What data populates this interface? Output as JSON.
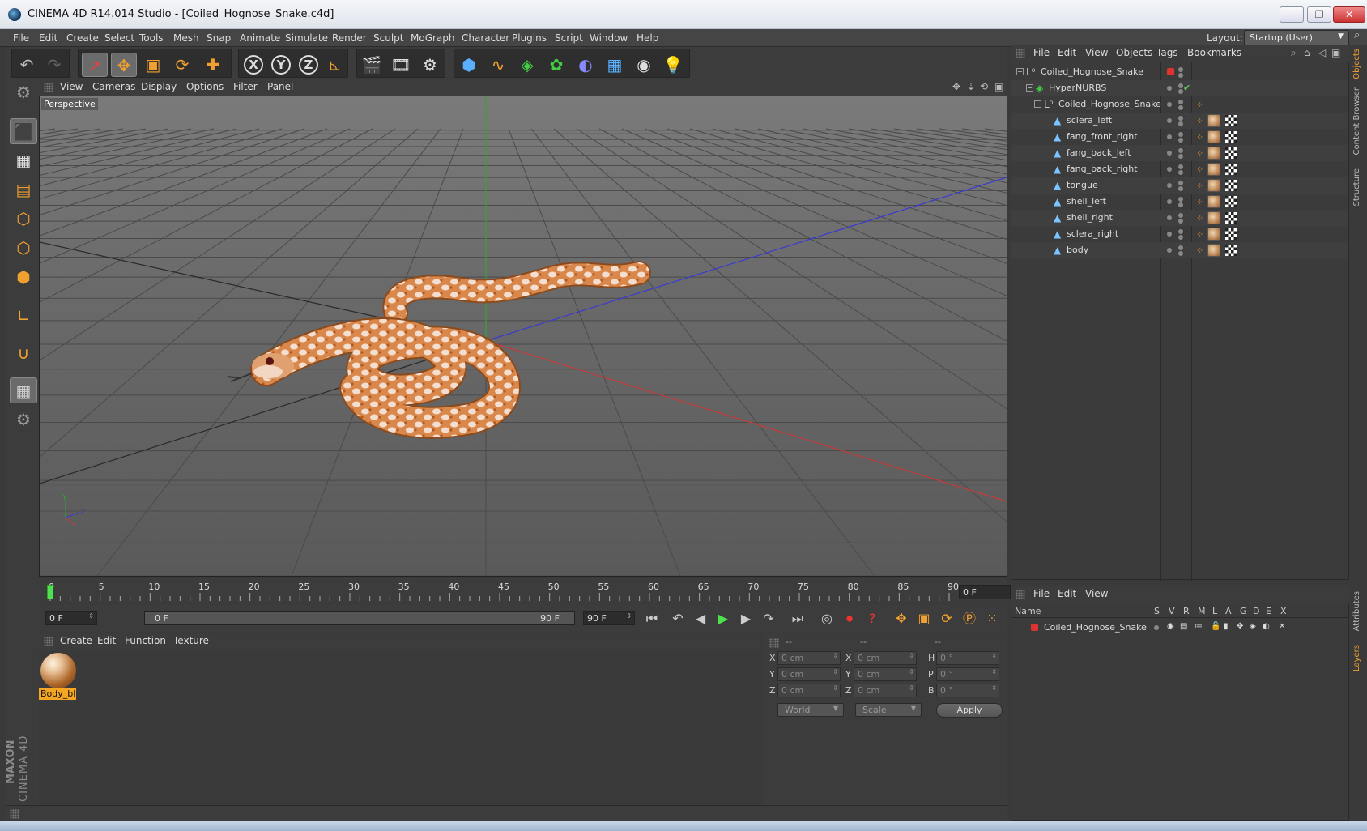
{
  "window": {
    "title": "CINEMA 4D R14.014 Studio - [Coiled_Hognose_Snake.c4d]",
    "minimize": "—",
    "restore": "❐",
    "close": "✕"
  },
  "menu": [
    "File",
    "Edit",
    "Create",
    "Select",
    "Tools",
    "Mesh",
    "Snap",
    "Animate",
    "Simulate",
    "Render",
    "Sculpt",
    "MoGraph",
    "Character",
    "Plugins",
    "Script",
    "Window",
    "Help"
  ],
  "layout": {
    "label": "Layout:",
    "value": "Startup (User)"
  },
  "main_toolbar": {
    "icons": [
      "undo-icon",
      "redo-icon",
      "live-selection-icon",
      "move-icon",
      "scale-icon",
      "rotate-icon",
      "add-icon",
      "x-axis-lock-icon",
      "y-axis-lock-icon",
      "z-axis-lock-icon",
      "coordinate-system-icon",
      "render-view-icon",
      "render-picture-viewer-icon",
      "render-settings-icon",
      "cube-primitive-icon",
      "spline-icon",
      "nurbs-icon",
      "array-icon",
      "deformer-icon",
      "floor-icon",
      "camera-icon",
      "light-icon"
    ],
    "x": "X",
    "y": "Y",
    "z": "Z"
  },
  "left_toolbar": {
    "icons": [
      "model-mode-icon",
      "texture-mode-icon",
      "workplane-icon",
      "points-mode-icon",
      "edges-mode-icon",
      "polygons-mode-icon",
      "axis-icon",
      "magnet-icon",
      "workplane-lock-icon",
      "soft-selection-icon"
    ]
  },
  "branding": {
    "maxon": "MAXON",
    "product": "CINEMA 4D"
  },
  "viewport": {
    "menu": [
      "View",
      "Cameras",
      "Display",
      "Options",
      "Filter",
      "Panel"
    ],
    "label": "Perspective",
    "nav_icons": [
      "pan-icon",
      "dolly-icon",
      "orbit-icon",
      "maximize-view-icon"
    ],
    "axis_colors": {
      "x": "#c83a3a",
      "y": "#2fa82f",
      "z": "#3a3ad0"
    }
  },
  "timeline": {
    "ticks": [
      "0",
      "5",
      "10",
      "15",
      "20",
      "25",
      "30",
      "35",
      "40",
      "45",
      "50",
      "55",
      "60",
      "65",
      "70",
      "75",
      "80",
      "85",
      "90"
    ],
    "current_frame": "0 F"
  },
  "transport": {
    "start_field": "0 F",
    "range_start": "0 F",
    "range_end": "90 F",
    "end_field": "90 F"
  },
  "material_manager": {
    "menu": [
      "Create",
      "Edit",
      "Function",
      "Texture"
    ],
    "materials": [
      {
        "name": "Body_bl"
      }
    ]
  },
  "coordinates": {
    "headers": [
      "--",
      "--",
      "--"
    ],
    "position": [
      {
        "axis": "X",
        "value": "0 cm"
      },
      {
        "axis": "Y",
        "value": "0 cm"
      },
      {
        "axis": "Z",
        "value": "0 cm"
      }
    ],
    "size": [
      {
        "axis": "X",
        "value": "0 cm"
      },
      {
        "axis": "Y",
        "value": "0 cm"
      },
      {
        "axis": "Z",
        "value": "0 cm"
      }
    ],
    "rotation": [
      {
        "axis": "H",
        "value": "0 °"
      },
      {
        "axis": "P",
        "value": "0 °"
      },
      {
        "axis": "B",
        "value": "0 °"
      }
    ],
    "mode1": "World",
    "mode2": "Scale",
    "apply": "Apply"
  },
  "objects_manager": {
    "menu": [
      "File",
      "Edit",
      "View",
      "Objects",
      "Tags",
      "Bookmarks"
    ],
    "objects": [
      {
        "name": "Coiled_Hognose_Snake",
        "type": "null"
      },
      {
        "name": "HyperNURBS",
        "type": "hypernurbs"
      },
      {
        "name": "Coiled_Hognose_Snake",
        "type": "null"
      },
      {
        "name": "sclera_left",
        "type": "polygon"
      },
      {
        "name": "fang_front_right",
        "type": "polygon"
      },
      {
        "name": "fang_back_left",
        "type": "polygon"
      },
      {
        "name": "fang_back_right",
        "type": "polygon"
      },
      {
        "name": "tongue",
        "type": "polygon"
      },
      {
        "name": "shell_left",
        "type": "polygon"
      },
      {
        "name": "shell_right",
        "type": "polygon"
      },
      {
        "name": "sclera_right",
        "type": "polygon"
      },
      {
        "name": "body",
        "type": "polygon"
      }
    ]
  },
  "side_tabs": [
    "Objects",
    "Content Browser",
    "Structure",
    "Attributes",
    "Layers"
  ],
  "layers_manager": {
    "menu": [
      "File",
      "Edit",
      "View"
    ],
    "columns": [
      "Name",
      "S",
      "V",
      "R",
      "M",
      "L",
      "A",
      "G",
      "D",
      "E",
      "X"
    ],
    "layers": [
      {
        "name": "Coiled_Hognose_Snake",
        "color": "#c8324a"
      }
    ]
  }
}
